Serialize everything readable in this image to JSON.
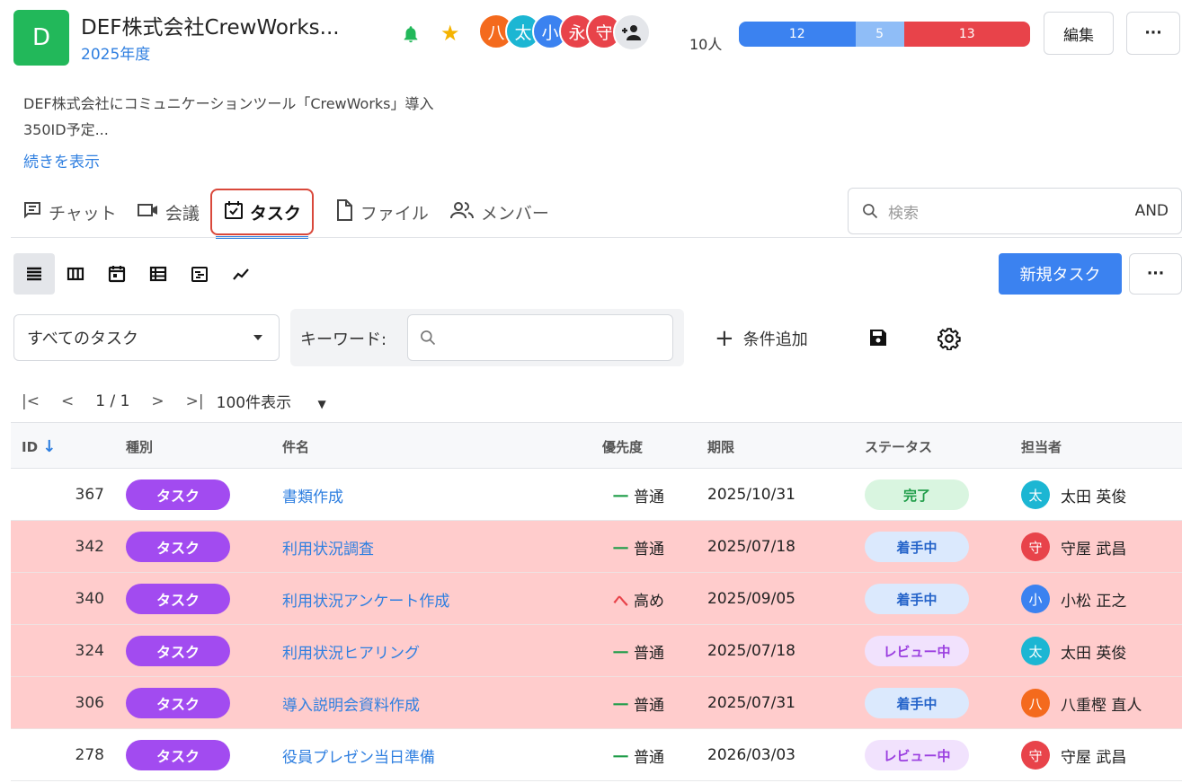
{
  "project": {
    "icon_letter": "D",
    "title": "DEF株式会社CrewWorks...",
    "year": "2025年度",
    "description_line1": "DEF株式会社にコミュニケーションツール「CrewWorks」導入",
    "description_line2": "350ID予定...",
    "show_more": "続きを表示"
  },
  "header": {
    "members": [
      {
        "char": "八",
        "color": "#f46a1d"
      },
      {
        "char": "太",
        "color": "#1cb6d3"
      },
      {
        "char": "小",
        "color": "#3b82f0"
      },
      {
        "char": "永",
        "color": "#e8434a"
      },
      {
        "char": "守",
        "color": "#e8434a"
      }
    ],
    "member_count": "10人",
    "progress": [
      {
        "value": "12",
        "color": "#3b82f0",
        "fraction": 0.4
      },
      {
        "value": "5",
        "color": "#8fbdf7",
        "fraction": 0.1667
      },
      {
        "value": "13",
        "color": "#e8434a",
        "fraction": 0.4333
      }
    ],
    "edit_label": "編集",
    "more_label": "···"
  },
  "tabs": [
    {
      "label": "チャット",
      "icon": "chat-icon"
    },
    {
      "label": "会議",
      "icon": "video-icon"
    },
    {
      "label": "タスク",
      "icon": "task-icon",
      "active": true
    },
    {
      "label": "ファイル",
      "icon": "file-icon"
    },
    {
      "label": "メンバー",
      "icon": "members-icon"
    }
  ],
  "search": {
    "placeholder": "検索",
    "mode": "AND"
  },
  "toolbar": {
    "new_task": "新規タスク",
    "more": "···"
  },
  "filter": {
    "selected": "すべてのタスク",
    "keyword_label": "キーワード:",
    "keyword_value": "",
    "add_condition": "条件追加"
  },
  "pager": {
    "page": "1 / 1",
    "per_page": "100件表示"
  },
  "table": {
    "columns": {
      "id": "ID",
      "type": "種別",
      "name": "件名",
      "priority": "優先度",
      "due": "期限",
      "status": "ステータス",
      "assignee": "担当者"
    },
    "rows": [
      {
        "id": "367",
        "type": "タスク",
        "name": "書類作成",
        "prio_mark": "一",
        "priority": "普通",
        "due": "2025/10/31",
        "status": "完了",
        "assignee_char": "太",
        "assignee": "太田 英俊",
        "alert": false
      },
      {
        "id": "342",
        "type": "タスク",
        "name": "利用状況調査",
        "prio_mark": "一",
        "priority": "普通",
        "due": "2025/07/18",
        "status": "着手中",
        "assignee_char": "守",
        "assignee": "守屋 武昌",
        "alert": true
      },
      {
        "id": "340",
        "type": "タスク",
        "name": "利用状況アンケート作成",
        "prio_mark": "へ",
        "priority": "高め",
        "due": "2025/09/05",
        "status": "着手中",
        "assignee_char": "小",
        "assignee": "小松 正之",
        "alert": true
      },
      {
        "id": "324",
        "type": "タスク",
        "name": "利用状況ヒアリング",
        "prio_mark": "一",
        "priority": "普通",
        "due": "2025/07/18",
        "status": "レビュー中",
        "assignee_char": "太",
        "assignee": "太田 英俊",
        "alert": true
      },
      {
        "id": "306",
        "type": "タスク",
        "name": "導入説明会資料作成",
        "prio_mark": "一",
        "priority": "普通",
        "due": "2025/07/31",
        "status": "着手中",
        "assignee_char": "八",
        "assignee": "八重樫 直人",
        "alert": true
      },
      {
        "id": "278",
        "type": "タスク",
        "name": "役員プレゼン当日準備",
        "prio_mark": "一",
        "priority": "普通",
        "due": "2026/03/03",
        "status": "レビュー中",
        "assignee_char": "守",
        "assignee": "守屋 武昌",
        "alert": false
      }
    ]
  },
  "colors": {
    "accent": "#3b82f0",
    "alert_row": "#ffcccc",
    "type_badge": "#a24bf0",
    "status_done_bg": "#d9f5e0",
    "status_done_fg": "#1f9d49",
    "status_progress_bg": "#dbe9fd",
    "status_progress_fg": "#2463c9",
    "status_review_bg": "#f1e2fd",
    "status_review_fg": "#9b3fe0",
    "prio_normal": "#1f9d49",
    "prio_high": "#e8434a"
  }
}
